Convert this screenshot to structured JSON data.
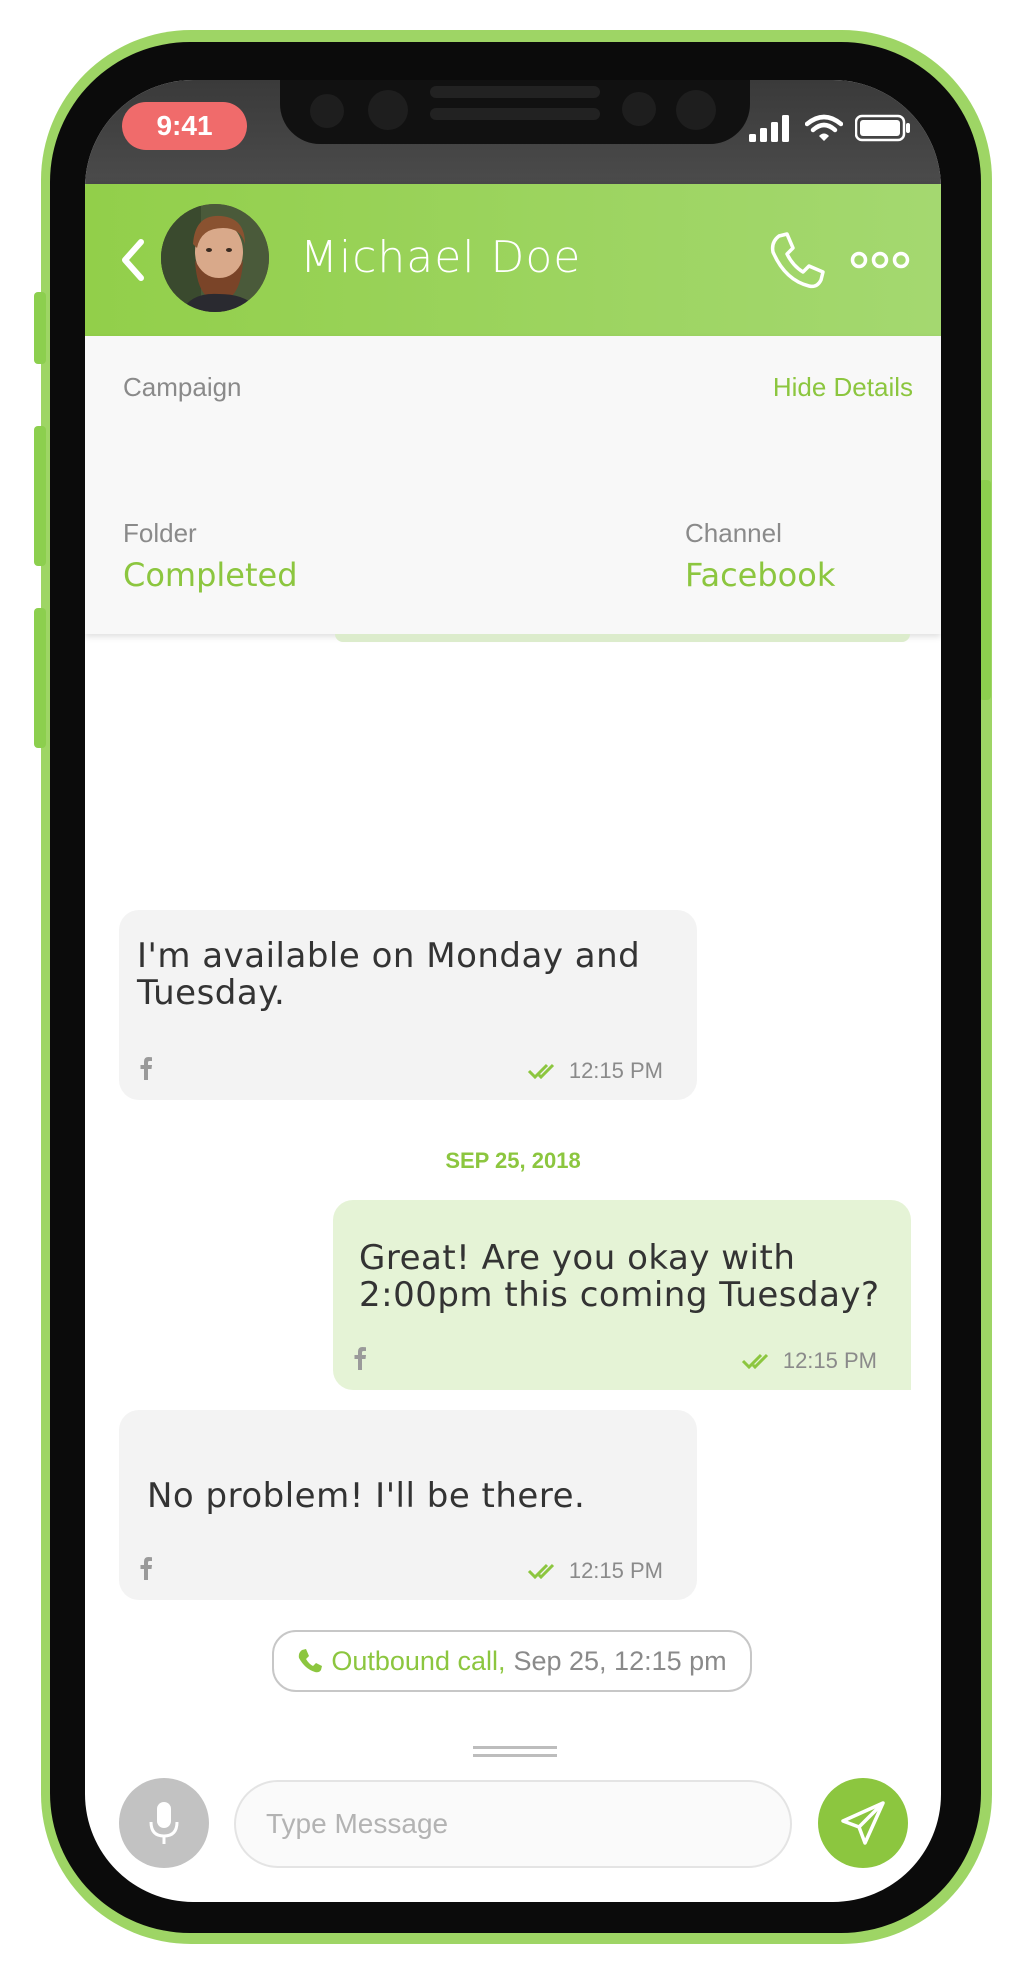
{
  "status_bar": {
    "time": "9:41"
  },
  "header": {
    "contact_name": "Michael Doe"
  },
  "details": {
    "campaign_label": "Campaign",
    "campaign_value": "",
    "hide_details_label": "Hide Details",
    "folder_label": "Folder",
    "folder_value": "Completed",
    "channel_label": "Channel",
    "channel_value": "Facebook"
  },
  "messages": [
    {
      "direction": "incoming",
      "text": "I'm available on Monday and Tuesday.",
      "channel_icon": "facebook-icon",
      "time": "12:15 PM"
    },
    {
      "direction": "outgoing",
      "text": "Great! Are you okay with 2:00pm this coming Tuesday?",
      "channel_icon": "facebook-icon",
      "time": "12:15 PM"
    },
    {
      "direction": "incoming",
      "text": "No problem! I'll be there.",
      "channel_icon": "facebook-icon",
      "time": "12:15 PM"
    }
  ],
  "date_separator": "SEP 25, 2018",
  "call_log": {
    "type_label": "Outbound call,",
    "timestamp": "Sep 25, 12:15 pm"
  },
  "composer": {
    "placeholder": "Type Message"
  },
  "colors": {
    "accent": "#8cc63f",
    "frame": "#9ed565",
    "time_pill": "#f06b6b"
  }
}
